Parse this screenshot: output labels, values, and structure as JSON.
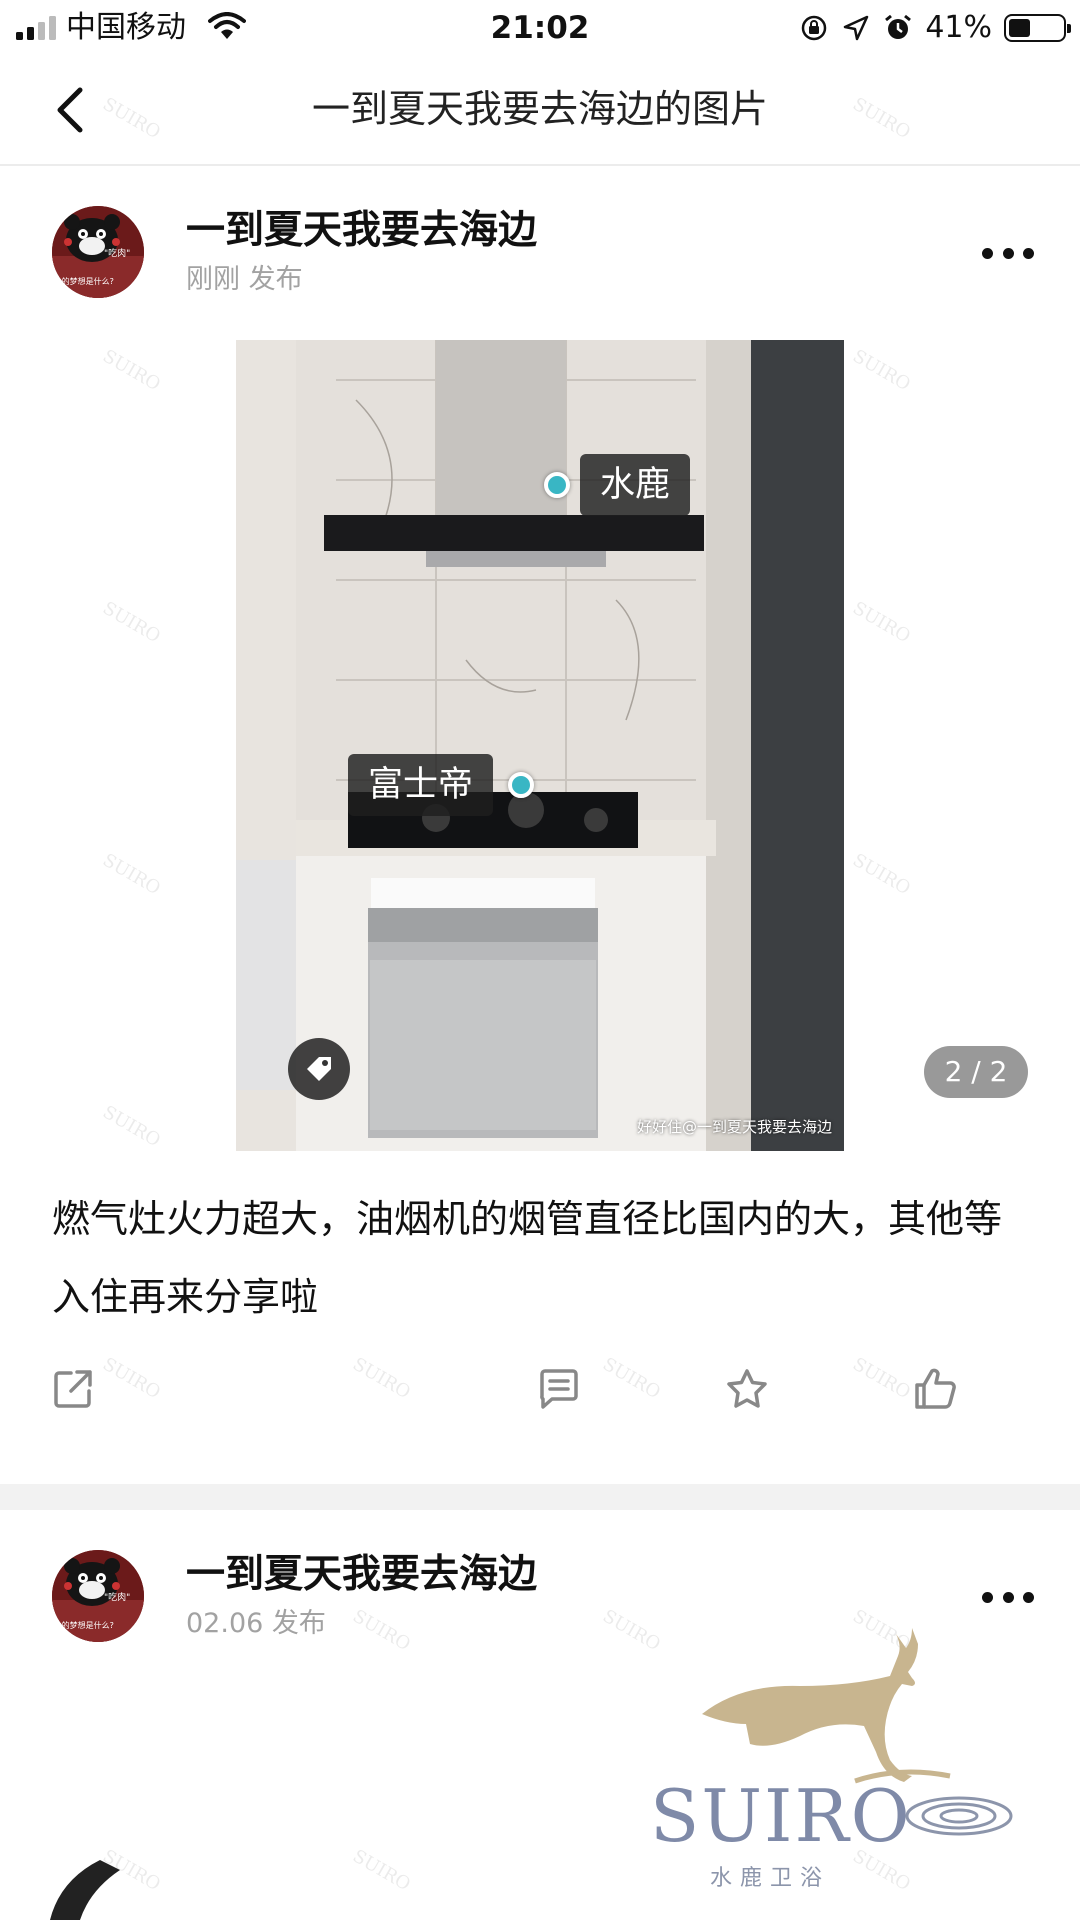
{
  "status_bar": {
    "carrier": "中国移动",
    "time": "21:02",
    "battery_percent": "41%",
    "battery_level": 0.41,
    "icons": [
      "signal-icon",
      "wifi-icon",
      "orientation-lock-icon",
      "location-icon",
      "alarm-icon",
      "battery-icon"
    ]
  },
  "nav": {
    "back_icon": "chevron-left-icon",
    "title": "一到夏天我要去海边的图片"
  },
  "posts": [
    {
      "author": "一到夏天我要去海边",
      "time": "刚刚 发布",
      "avatar_text": [
        "\"吃肉\"",
        "...的梦想是什么?"
      ],
      "photo": {
        "tags": [
          "水鹿",
          "富士帝"
        ],
        "watermark": "好好住@一到夏天我要去海边",
        "page_indicator": "2 / 2"
      },
      "text": "燃气灶火力超大，油烟机的烟管直径比国内的大，其他等入住再来分享啦",
      "actions": [
        "share-icon",
        "comment-icon",
        "star-icon",
        "like-icon"
      ]
    },
    {
      "author": "一到夏天我要去海边",
      "time": "02.06 发布",
      "avatar_text": [
        "\"吃肉\"",
        "...的梦想是什么?"
      ]
    }
  ],
  "brand": {
    "name": "SUIRO",
    "sub": "水鹿卫浴",
    "watermark": "SUIRO",
    "deer_color": "#c8b58f"
  }
}
